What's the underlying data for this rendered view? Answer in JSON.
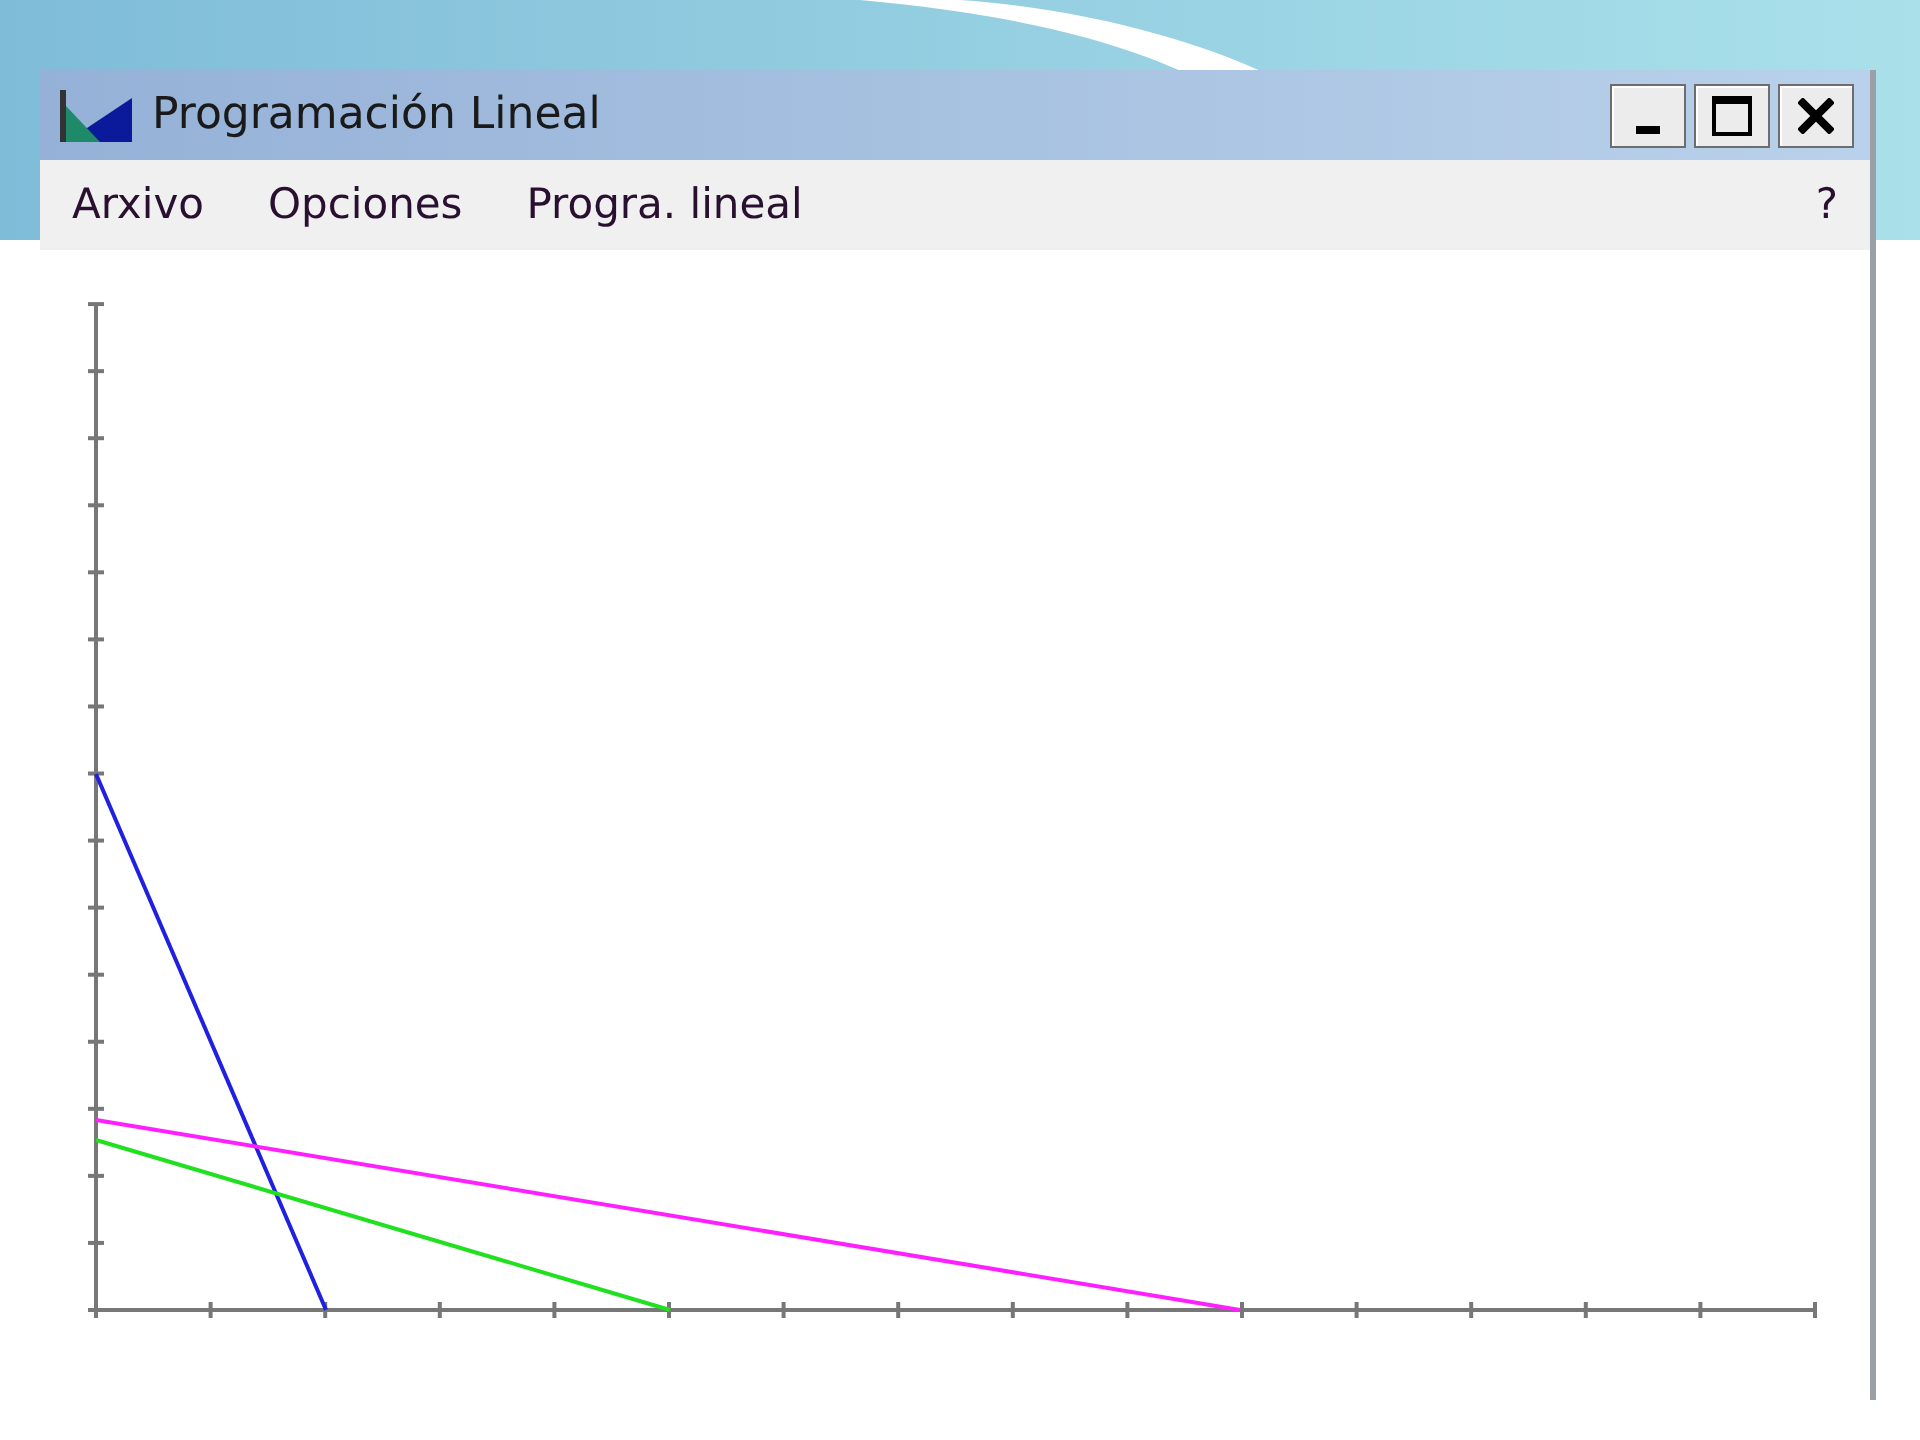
{
  "window": {
    "title": "Programación Lineal"
  },
  "menu": [
    {
      "label": "Arxivo"
    },
    {
      "label": "Opciones"
    },
    {
      "label": "Progra. lineal"
    }
  ],
  "help": "?"
}
